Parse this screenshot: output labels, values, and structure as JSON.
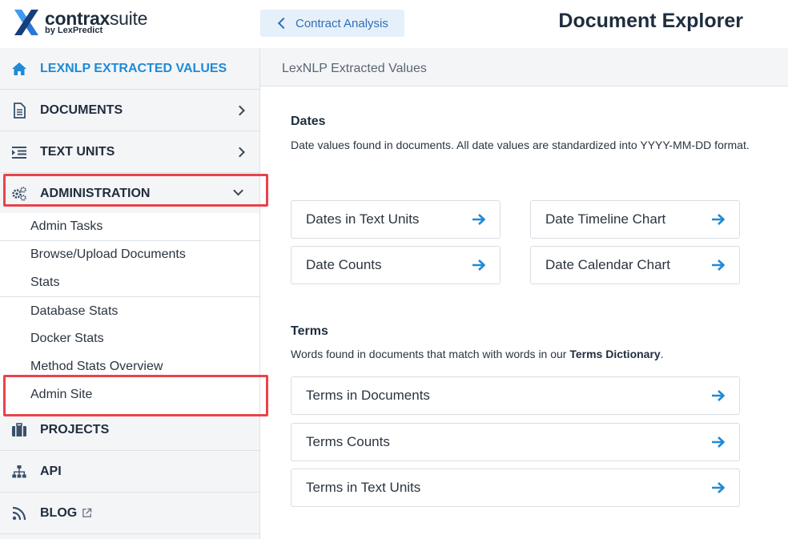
{
  "header": {
    "logo_bold": "contrax",
    "logo_light": "suite",
    "logo_sub": "by LexPredict",
    "back_label": "Contract Analysis",
    "page_title": "Document Explorer"
  },
  "sidebar": {
    "items": [
      {
        "label": "LEXNLP EXTRACTED VALUES",
        "icon": "home-icon"
      },
      {
        "label": "DOCUMENTS",
        "icon": "document-icon"
      },
      {
        "label": "TEXT UNITS",
        "icon": "list-indent-icon"
      },
      {
        "label": "ADMINISTRATION",
        "icon": "gears-icon"
      },
      {
        "label": "PROJECTS",
        "icon": "briefcase-icon"
      },
      {
        "label": "API",
        "icon": "sitemap-icon"
      },
      {
        "label": "BLOG",
        "icon": "rss-icon"
      }
    ],
    "admin_submenu": [
      "Admin Tasks",
      "Browse/Upload Documents",
      "Stats",
      "Database Stats",
      "Docker Stats",
      "Method Stats Overview",
      "Admin Site"
    ]
  },
  "main": {
    "breadcrumb": "LexNLP Extracted Values",
    "dates": {
      "title": "Dates",
      "description": "Date values found in documents. All date values are standardized into YYYY-MM-DD format.",
      "cards": [
        "Dates in Text Units",
        "Date Timeline Chart",
        "Date Counts",
        "Date Calendar Chart"
      ]
    },
    "terms": {
      "title": "Terms",
      "description_pre": "Words found in documents that match with words in our ",
      "description_bold": "Terms Dictionary",
      "description_post": ".",
      "cards": [
        "Terms in Documents",
        "Terms Counts",
        "Terms in Text Units"
      ]
    }
  },
  "colors": {
    "accent_blue": "#1f8ad6",
    "highlight_red": "#e8434a",
    "dark_text": "#1f2d3d",
    "sidebar_bg": "#f4f5f7"
  }
}
